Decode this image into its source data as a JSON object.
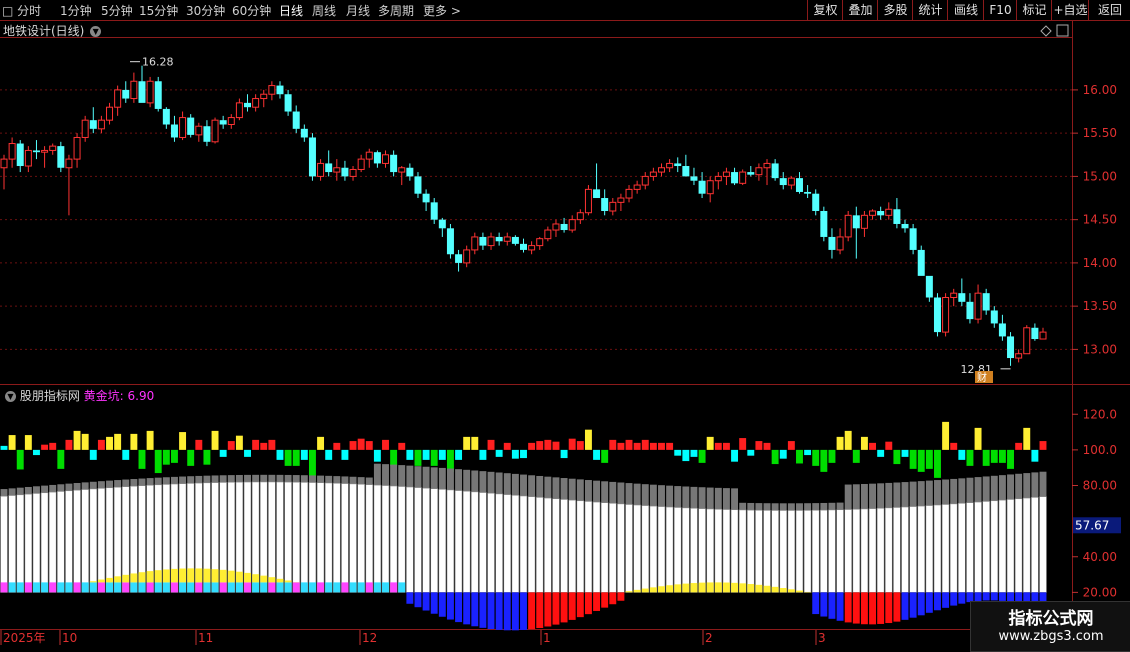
{
  "toolbar": {
    "periods": [
      "分时",
      "1分钟",
      "5分钟",
      "15分钟",
      "30分钟",
      "60分钟",
      "日线",
      "周线",
      "月线",
      "多周期",
      "更多 >"
    ],
    "active_period": "日线",
    "right_buttons": [
      "复权",
      "叠加",
      "多股",
      "统计",
      "画线",
      "F10",
      "标记",
      "+自选",
      "返回"
    ]
  },
  "main_chart": {
    "title": "地铁设计(日线)",
    "high_label": "16.28",
    "low_label": "12.81",
    "event_badge": "财",
    "price_ticks": [
      "16.00",
      "15.50",
      "15.00",
      "14.50",
      "14.00",
      "13.50",
      "13.00"
    ],
    "price_range": [
      12.6,
      16.6
    ],
    "up_color": "#ff3333",
    "down_color": "#54ffff"
  },
  "indicator": {
    "name": "股朋指标网",
    "sub_label": "黄金坑:",
    "sub_value": "6.90",
    "ticks": [
      "120.0",
      "100.0",
      "80.00",
      "40.00",
      "20.00"
    ],
    "current_value": "57.67",
    "range": [
      0,
      128
    ]
  },
  "time_axis": {
    "labels": [
      "2025年",
      "10",
      "11",
      "12",
      "1",
      "2",
      "3"
    ]
  },
  "watermark": {
    "line1": "指标公式网",
    "line2": "www.zbgs3.com"
  },
  "chart_data": {
    "type": "candlestick",
    "ohlc": [
      [
        15.1,
        15.25,
        14.85,
        15.2
      ],
      [
        15.2,
        15.45,
        15.1,
        15.38
      ],
      [
        15.38,
        15.42,
        15.05,
        15.12
      ],
      [
        15.12,
        15.35,
        15.05,
        15.3
      ],
      [
        15.3,
        15.42,
        15.2,
        15.28
      ],
      [
        15.28,
        15.35,
        15.1,
        15.3
      ],
      [
        15.3,
        15.38,
        15.25,
        15.35
      ],
      [
        15.35,
        15.4,
        15.05,
        15.1
      ],
      [
        15.1,
        15.25,
        14.55,
        15.2
      ],
      [
        15.2,
        15.5,
        15.1,
        15.45
      ],
      [
        15.45,
        15.7,
        15.4,
        15.65
      ],
      [
        15.65,
        15.8,
        15.5,
        15.55
      ],
      [
        15.55,
        15.7,
        15.5,
        15.65
      ],
      [
        15.65,
        15.85,
        15.6,
        15.8
      ],
      [
        15.8,
        16.05,
        15.7,
        16.0
      ],
      [
        16.0,
        16.1,
        15.85,
        15.9
      ],
      [
        15.9,
        16.2,
        15.85,
        16.1
      ],
      [
        16.1,
        16.28,
        15.9,
        15.85
      ],
      [
        15.85,
        16.15,
        15.8,
        16.1
      ],
      [
        16.1,
        16.15,
        15.75,
        15.78
      ],
      [
        15.78,
        15.8,
        15.55,
        15.6
      ],
      [
        15.6,
        15.7,
        15.4,
        15.45
      ],
      [
        15.45,
        15.75,
        15.42,
        15.68
      ],
      [
        15.68,
        15.72,
        15.45,
        15.48
      ],
      [
        15.48,
        15.62,
        15.4,
        15.58
      ],
      [
        15.58,
        15.65,
        15.35,
        15.4
      ],
      [
        15.4,
        15.68,
        15.38,
        15.65
      ],
      [
        15.65,
        15.7,
        15.55,
        15.6
      ],
      [
        15.6,
        15.72,
        15.55,
        15.68
      ],
      [
        15.68,
        15.9,
        15.65,
        15.85
      ],
      [
        15.85,
        15.95,
        15.75,
        15.8
      ],
      [
        15.8,
        15.95,
        15.75,
        15.9
      ],
      [
        15.9,
        16.0,
        15.8,
        15.95
      ],
      [
        15.95,
        16.1,
        15.88,
        16.05
      ],
      [
        16.05,
        16.1,
        15.9,
        15.95
      ],
      [
        15.95,
        16.0,
        15.7,
        15.75
      ],
      [
        15.75,
        15.82,
        15.5,
        15.55
      ],
      [
        15.55,
        15.6,
        15.4,
        15.45
      ],
      [
        15.45,
        15.5,
        14.95,
        15.0
      ],
      [
        15.0,
        15.2,
        14.95,
        15.15
      ],
      [
        15.15,
        15.3,
        15.0,
        15.05
      ],
      [
        15.05,
        15.2,
        14.95,
        15.1
      ],
      [
        15.1,
        15.18,
        14.95,
        15.0
      ],
      [
        15.0,
        15.12,
        14.95,
        15.08
      ],
      [
        15.08,
        15.25,
        15.05,
        15.2
      ],
      [
        15.2,
        15.32,
        15.1,
        15.28
      ],
      [
        15.28,
        15.3,
        15.1,
        15.15
      ],
      [
        15.15,
        15.3,
        15.1,
        15.25
      ],
      [
        15.25,
        15.3,
        15.0,
        15.05
      ],
      [
        15.05,
        15.12,
        14.9,
        15.1
      ],
      [
        15.1,
        15.15,
        14.95,
        15.0
      ],
      [
        15.0,
        15.05,
        14.75,
        14.8
      ],
      [
        14.8,
        14.85,
        14.6,
        14.7
      ],
      [
        14.7,
        14.75,
        14.45,
        14.5
      ],
      [
        14.5,
        14.52,
        14.3,
        14.4
      ],
      [
        14.4,
        14.45,
        14.05,
        14.1
      ],
      [
        14.1,
        14.15,
        13.9,
        14.0
      ],
      [
        14.0,
        14.2,
        13.95,
        14.15
      ],
      [
        14.15,
        14.35,
        14.1,
        14.3
      ],
      [
        14.3,
        14.35,
        14.15,
        14.2
      ],
      [
        14.2,
        14.35,
        14.15,
        14.3
      ],
      [
        14.3,
        14.35,
        14.2,
        14.25
      ],
      [
        14.25,
        14.35,
        14.2,
        14.3
      ],
      [
        14.3,
        14.32,
        14.2,
        14.22
      ],
      [
        14.22,
        14.28,
        14.12,
        14.15
      ],
      [
        14.15,
        14.25,
        14.1,
        14.2
      ],
      [
        14.2,
        14.3,
        14.15,
        14.28
      ],
      [
        14.28,
        14.42,
        14.25,
        14.38
      ],
      [
        14.38,
        14.5,
        14.3,
        14.45
      ],
      [
        14.45,
        14.52,
        14.35,
        14.38
      ],
      [
        14.38,
        14.55,
        14.35,
        14.5
      ],
      [
        14.5,
        14.62,
        14.45,
        14.58
      ],
      [
        14.58,
        14.9,
        14.55,
        14.85
      ],
      [
        14.85,
        15.15,
        14.8,
        14.75
      ],
      [
        14.75,
        14.85,
        14.55,
        14.6
      ],
      [
        14.6,
        14.75,
        14.55,
        14.7
      ],
      [
        14.7,
        14.8,
        14.6,
        14.75
      ],
      [
        14.75,
        14.9,
        14.7,
        14.85
      ],
      [
        14.85,
        14.95,
        14.8,
        14.9
      ],
      [
        14.9,
        15.05,
        14.85,
        15.0
      ],
      [
        15.0,
        15.1,
        14.95,
        15.05
      ],
      [
        15.05,
        15.15,
        15.0,
        15.1
      ],
      [
        15.1,
        15.2,
        15.05,
        15.15
      ],
      [
        15.15,
        15.22,
        15.05,
        15.12
      ],
      [
        15.12,
        15.25,
        15.05,
        15.0
      ],
      [
        15.0,
        15.1,
        14.9,
        14.95
      ],
      [
        14.95,
        15.05,
        14.75,
        14.8
      ],
      [
        14.8,
        15.0,
        14.7,
        14.95
      ],
      [
        14.95,
        15.05,
        14.85,
        15.0
      ],
      [
        15.0,
        15.1,
        14.9,
        15.05
      ],
      [
        15.05,
        15.1,
        14.9,
        14.92
      ],
      [
        14.92,
        15.08,
        14.9,
        15.05
      ],
      [
        15.05,
        15.12,
        15.0,
        15.02
      ],
      [
        15.02,
        15.15,
        14.95,
        15.1
      ],
      [
        15.1,
        15.2,
        14.9,
        15.15
      ],
      [
        15.15,
        15.2,
        14.95,
        14.98
      ],
      [
        14.98,
        15.05,
        14.85,
        14.9
      ],
      [
        14.9,
        15.0,
        14.85,
        14.98
      ],
      [
        14.98,
        15.05,
        14.8,
        14.82
      ],
      [
        14.82,
        14.9,
        14.75,
        14.8
      ],
      [
        14.8,
        14.85,
        14.55,
        14.6
      ],
      [
        14.6,
        14.65,
        14.25,
        14.3
      ],
      [
        14.3,
        14.4,
        14.05,
        14.15
      ],
      [
        14.15,
        14.4,
        14.1,
        14.3
      ],
      [
        14.3,
        14.6,
        14.25,
        14.55
      ],
      [
        14.55,
        14.65,
        14.05,
        14.4
      ],
      [
        14.4,
        14.6,
        14.3,
        14.55
      ],
      [
        14.55,
        14.62,
        14.5,
        14.6
      ],
      [
        14.6,
        14.65,
        14.5,
        14.55
      ],
      [
        14.55,
        14.7,
        14.5,
        14.62
      ],
      [
        14.62,
        14.75,
        14.4,
        14.45
      ],
      [
        14.45,
        14.5,
        14.35,
        14.4
      ],
      [
        14.4,
        14.45,
        14.1,
        14.15
      ],
      [
        14.15,
        14.2,
        13.9,
        13.85
      ],
      [
        13.85,
        13.7,
        13.55,
        13.6
      ],
      [
        13.6,
        13.65,
        13.15,
        13.2
      ],
      [
        13.2,
        13.65,
        13.15,
        13.6
      ],
      [
        13.6,
        13.7,
        13.5,
        13.65
      ],
      [
        13.65,
        13.82,
        13.5,
        13.55
      ],
      [
        13.55,
        13.65,
        13.3,
        13.35
      ],
      [
        13.35,
        13.75,
        13.3,
        13.65
      ],
      [
        13.65,
        13.7,
        13.4,
        13.45
      ],
      [
        13.45,
        13.5,
        13.25,
        13.3
      ],
      [
        13.3,
        13.4,
        13.1,
        13.15
      ],
      [
        13.15,
        13.2,
        12.81,
        12.9
      ],
      [
        12.9,
        13.0,
        12.85,
        12.95
      ],
      [
        12.95,
        13.28,
        12.95,
        13.25
      ],
      [
        13.25,
        13.3,
        13.1,
        13.12
      ],
      [
        13.12,
        13.25,
        13.15,
        13.2
      ]
    ]
  }
}
